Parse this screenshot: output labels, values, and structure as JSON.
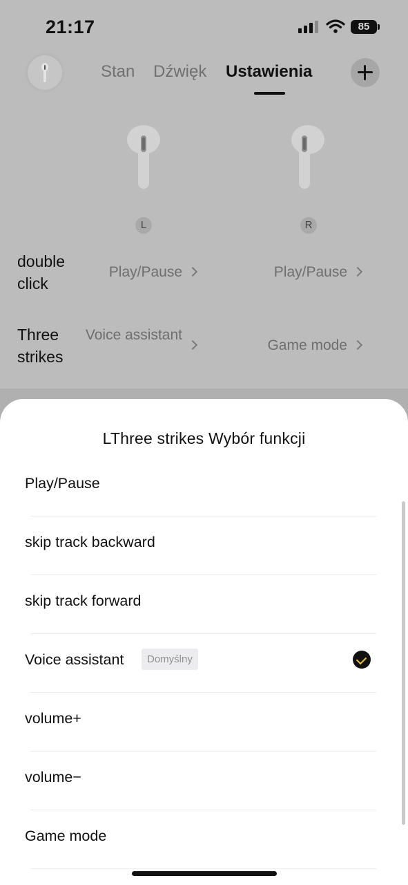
{
  "status_bar": {
    "time": "21:17",
    "battery": "85"
  },
  "tabs": [
    {
      "label": "Stan"
    },
    {
      "label": "Dźwięk"
    },
    {
      "label": "Ustawienia"
    }
  ],
  "earbuds": {
    "left_label": "L",
    "right_label": "R"
  },
  "controls": [
    {
      "label": "double click",
      "left": "Play/Pause",
      "right": "Play/Pause"
    },
    {
      "label": "Three strikes",
      "left": "Voice assistant",
      "right": "Game mode"
    }
  ],
  "sheet": {
    "title": "LThree strikes Wybór funkcji",
    "default_badge": "Domyślny",
    "options": [
      {
        "label": "Play/Pause"
      },
      {
        "label": "skip track backward"
      },
      {
        "label": "skip track forward"
      },
      {
        "label": "Voice assistant",
        "selected": true,
        "is_default": true
      },
      {
        "label": "volume+"
      },
      {
        "label": "volume−"
      },
      {
        "label": "Game mode"
      }
    ]
  },
  "colors": {
    "selected_check": "#f2c12e",
    "overlay": "#bcbcbc"
  }
}
